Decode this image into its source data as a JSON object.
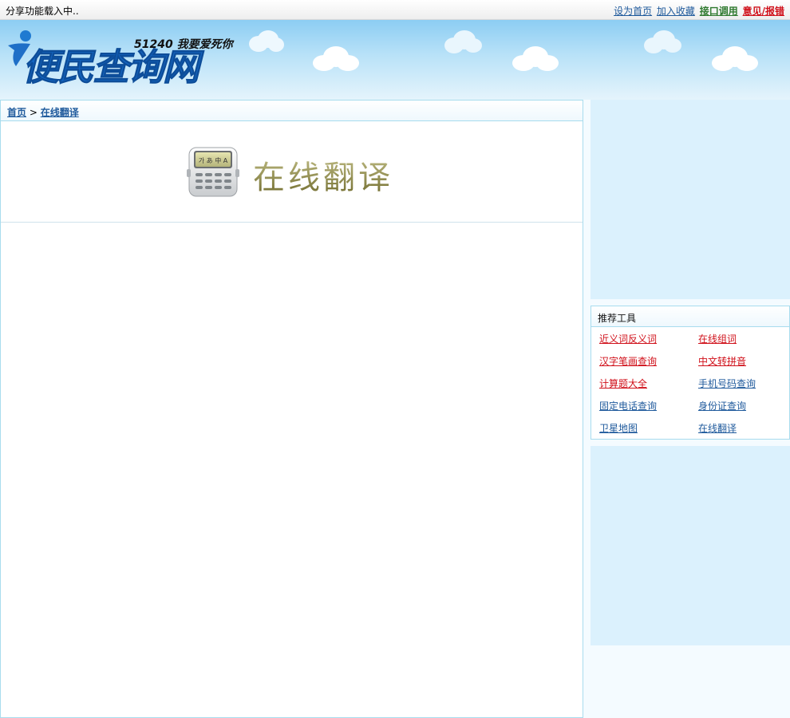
{
  "topbar": {
    "share_status": "分享功能载入中..",
    "links": [
      {
        "label": "设为首页",
        "color": "#1f5a9c"
      },
      {
        "label": "加入收藏",
        "color": "#1f5a9c"
      },
      {
        "label": "接口调用",
        "color": "#2f7a2f"
      },
      {
        "label": "意见/报错",
        "color": "#d0101a"
      }
    ]
  },
  "header": {
    "logo_text": "便民查询网",
    "logo_slogan": "51240 我要爱死你"
  },
  "breadcrumb": {
    "home": "首页",
    "separator": ">",
    "current": "在线翻译"
  },
  "banner": {
    "icon": "translator-device-icon",
    "icon_screen_text": "가 あ 中 A",
    "title": "在线翻译"
  },
  "sidebar": {
    "tools_title": "推荐工具",
    "tools": [
      {
        "label": "近义词反义词",
        "color": "#d0101a"
      },
      {
        "label": "在线组词",
        "color": "#d0101a"
      },
      {
        "label": "汉字笔画查询",
        "color": "#d0101a"
      },
      {
        "label": "中文转拼音",
        "color": "#d0101a"
      },
      {
        "label": "计算题大全",
        "color": "#d0101a"
      },
      {
        "label": "手机号码查询",
        "color": "#1f5a9c"
      },
      {
        "label": "固定电话查询",
        "color": "#1f5a9c"
      },
      {
        "label": "身份证查询",
        "color": "#1f5a9c"
      },
      {
        "label": "卫星地图",
        "color": "#1f5a9c"
      },
      {
        "label": "在线翻译",
        "color": "#1f5a9c"
      }
    ]
  }
}
